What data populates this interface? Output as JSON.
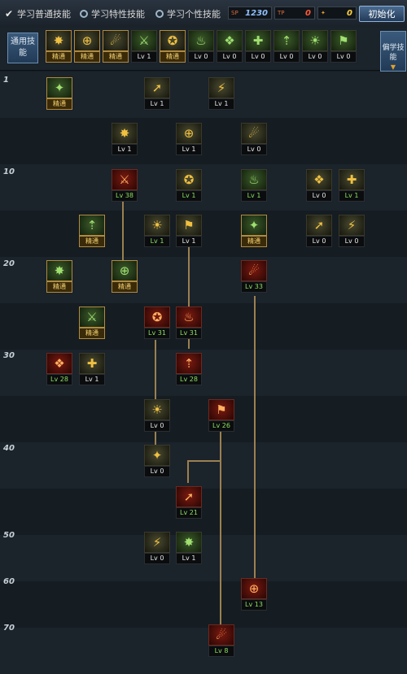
{
  "top": {
    "tab_common": "学习普通技能",
    "tab_special": "学习特性技能",
    "tab_personal": "学习个性技能",
    "stat_sp_label": "SP",
    "stat_sp": "1230",
    "stat_tp_label": "TP",
    "stat_tp": "0",
    "stat_qp": "0",
    "reset_label": "初始化"
  },
  "common_label": "通用技能",
  "learned_label": "偏学技能",
  "levels": [
    "1",
    "10",
    "20",
    "30",
    "40",
    "50",
    "60",
    "70"
  ],
  "common_skills": [
    "精通",
    "精通",
    "精通",
    "Lv 1",
    "精通",
    "Lv 0",
    "Lv 0",
    "Lv 0",
    "Lv 0",
    "Lv 0",
    "Lv 0"
  ],
  "skills": [
    {
      "t": "精通"
    },
    {
      "t": "Lv 1"
    },
    {
      "t": "Lv 1"
    },
    {
      "t": "Lv 1"
    },
    {
      "t": "Lv 1"
    },
    {
      "t": "Lv 0"
    },
    {
      "t": "Lv 38"
    },
    {
      "t": "Lv 1"
    },
    {
      "t": "Lv 1"
    },
    {
      "t": "Lv 0"
    },
    {
      "t": "Lv 1"
    },
    {
      "t": "精通"
    },
    {
      "t": "Lv 1"
    },
    {
      "t": "Lv 1"
    },
    {
      "t": "精通"
    },
    {
      "t": "Lv 0"
    },
    {
      "t": "Lv 0"
    },
    {
      "t": "精通"
    },
    {
      "t": "精通"
    },
    {
      "t": "Lv 33"
    },
    {
      "t": "精通"
    },
    {
      "t": "Lv 31"
    },
    {
      "t": "Lv 31"
    },
    {
      "t": "Lv 28"
    },
    {
      "t": "Lv 1"
    },
    {
      "t": "Lv 28"
    },
    {
      "t": "Lv 0"
    },
    {
      "t": "Lv 26"
    },
    {
      "t": "Lv 0"
    },
    {
      "t": "Lv 21"
    },
    {
      "t": "Lv 0"
    },
    {
      "t": "Lv 1"
    },
    {
      "t": "Lv 13"
    },
    {
      "t": "Lv 8"
    }
  ]
}
